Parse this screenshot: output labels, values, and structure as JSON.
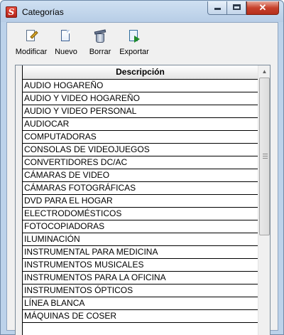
{
  "window": {
    "title": "Categorías",
    "app_icon": "S",
    "controls": {
      "minimize_icon": "minimize-icon",
      "maximize_icon": "maximize-icon",
      "close_glyph": "✕"
    }
  },
  "toolbar": {
    "modify_label": "Modificar",
    "new_label": "Nuevo",
    "delete_label": "Borrar",
    "export_label": "Exportar"
  },
  "grid": {
    "column_header": "Descripción",
    "rows": [
      "AUDIO HOGAREÑO",
      "AUDIO Y VIDEO HOGAREÑO",
      "AUDIO Y VIDEO PERSONAL",
      "AUDIOCAR",
      "COMPUTADORAS",
      "CONSOLAS DE VIDEOJUEGOS",
      "CONVERTIDORES DC/AC",
      "CÁMARAS DE VIDEO",
      "CÁMARAS FOTOGRÁFICAS",
      "DVD PARA EL HOGAR",
      "ELECTRODOMÉSTICOS",
      "FOTOCOPIADORAS",
      "ILUMINACIÓN",
      "INSTRUMENTAL PARA MEDICINA",
      "INSTRUMENTOS MUSICALES",
      "INSTRUMENTOS PARA LA OFICINA",
      "INSTRUMENTOS ÓPTICOS",
      "LÍNEA BLANCA",
      "MÁQUINAS DE COSER"
    ]
  },
  "scrollbar": {
    "up_glyph": "▲",
    "down_glyph": "▼"
  },
  "colors": {
    "window_frame": "#bcd2ea",
    "close_button": "#c7412c",
    "client_bg": "#f0f0f0"
  }
}
